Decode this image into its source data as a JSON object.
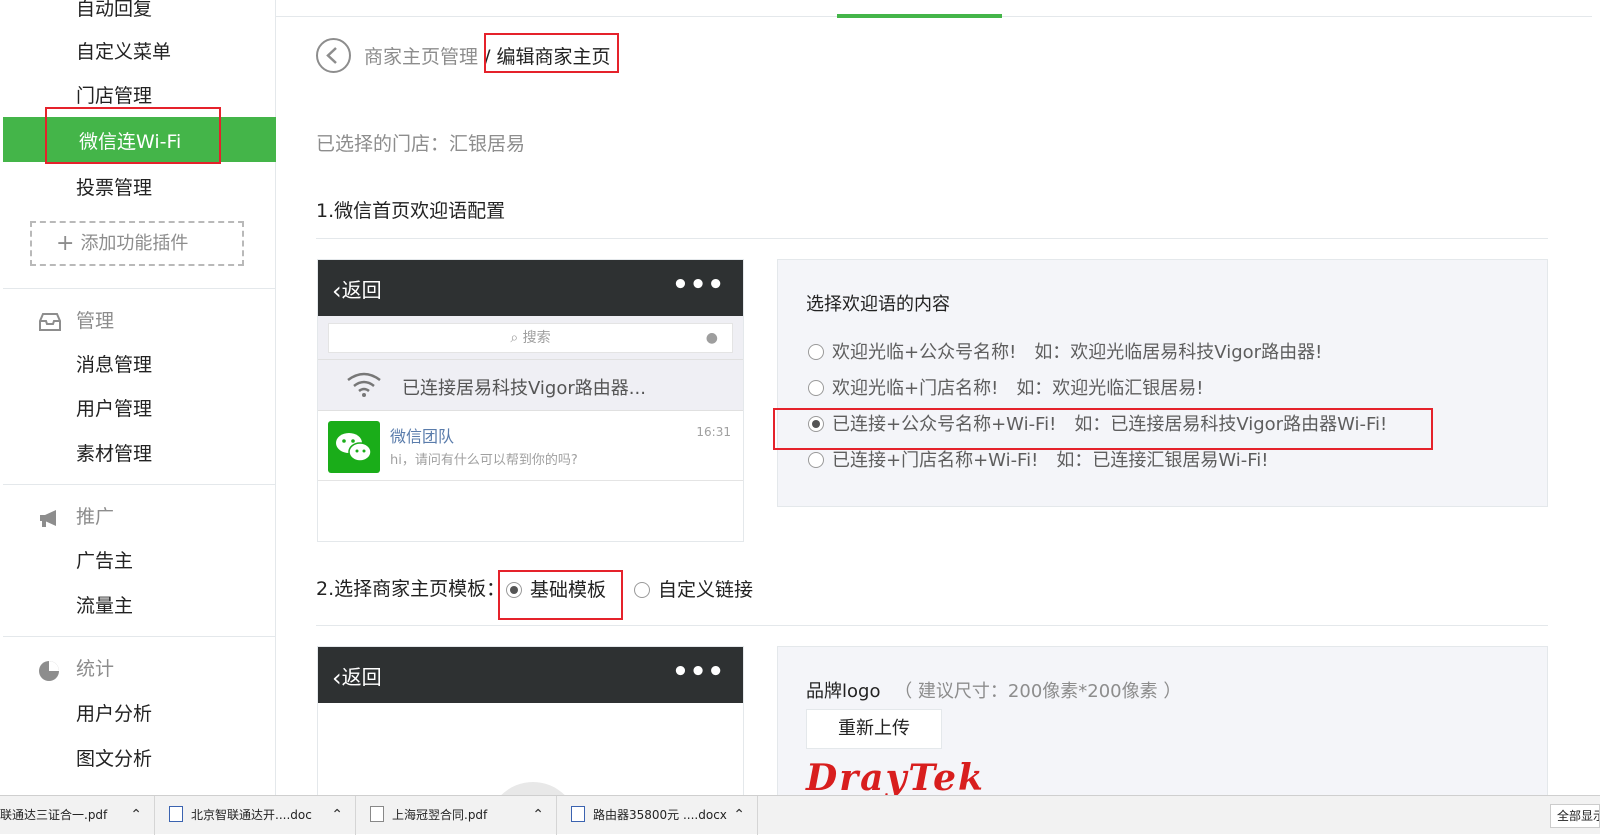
{
  "sidebar": {
    "items_top": [
      {
        "label": "自动回复"
      },
      {
        "label": "自定义菜单"
      },
      {
        "label": "门店管理"
      }
    ],
    "active_item": {
      "label": "微信连Wi-Fi"
    },
    "item_vote": {
      "label": "投票管理"
    },
    "add_plugin": {
      "label": "添加功能插件"
    },
    "groups": {
      "manage": {
        "label": "管理",
        "items": [
          "消息管理",
          "用户管理",
          "素材管理"
        ]
      },
      "promote": {
        "label": "推广",
        "items": [
          "广告主",
          "流量主"
        ]
      },
      "stats": {
        "label": "统计",
        "items": [
          "用户分析",
          "图文分析"
        ]
      }
    }
  },
  "breadcrumb": {
    "parent": "商家主页管理",
    "separator": "/",
    "current": "编辑商家主页"
  },
  "selected_store": "已选择的门店：汇银居易",
  "section1": {
    "title": "1.微信首页欢迎语配置",
    "phone": {
      "back_label": "返回",
      "menu": "•••",
      "search_placeholder": "搜索",
      "wifi_text": "已连接居易科技Vigor路由器...",
      "chat_name": "微信团队",
      "chat_msg": "hi，请问有什么可以帮到你的吗?",
      "chat_time": "16:31"
    },
    "panel": {
      "title": "选择欢迎语的内容",
      "options": [
        {
          "text": "欢迎光临+公众号名称!",
          "example": "如：欢迎光临居易科技Vigor路由器!",
          "selected": false
        },
        {
          "text": "欢迎光临+门店名称!",
          "example": "如：欢迎光临汇银居易!",
          "selected": false
        },
        {
          "text": "已连接+公众号名称+Wi-Fi!",
          "example": "如：已连接居易科技Vigor路由器Wi-Fi!",
          "selected": true
        },
        {
          "text": "已连接+门店名称+Wi-Fi!",
          "example": "如：已连接汇银居易Wi-Fi!",
          "selected": false
        }
      ]
    }
  },
  "section2": {
    "title": "2.选择商家主页模板：",
    "options": [
      {
        "label": "基础模板",
        "selected": true
      },
      {
        "label": "自定义链接",
        "selected": false
      }
    ],
    "phone": {
      "back_label": "返回",
      "menu": "•••"
    },
    "brand": {
      "label": "品牌logo",
      "hint": "（ 建议尺寸：200像素*200像素 ）",
      "upload_label": "重新上传",
      "logo_text": "DrayTek"
    }
  },
  "taskbar": {
    "items": [
      {
        "label": "联通达三证合一.pdf"
      },
      {
        "label": "北京智联通达开....doc"
      },
      {
        "label": "上海冠翌合同.pdf"
      },
      {
        "label": "路由器35800元 ....docx"
      }
    ],
    "show_all": "全部显示"
  },
  "colors": {
    "accent": "#44b549",
    "highlight": "#e5222b",
    "phone_header": "#2e3132"
  }
}
